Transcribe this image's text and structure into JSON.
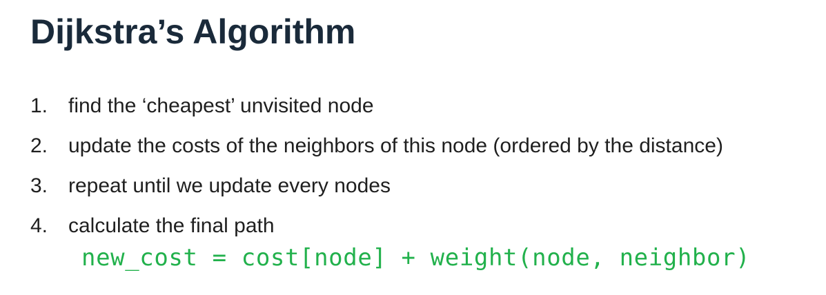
{
  "colors": {
    "title": "#1a2a3a",
    "text": "#1f1f1f",
    "code": "#22b14c",
    "background": "#ffffff"
  },
  "slide": {
    "title": "Dijkstra’s Algorithm",
    "steps": [
      {
        "number": "1.",
        "text": "find the ‘cheapest’ unvisited node"
      },
      {
        "number": "2.",
        "text": "update the costs of the neighbors of this node (ordered by the distance)"
      },
      {
        "number": "3.",
        "text": "repeat until we update every nodes"
      },
      {
        "number": "4.",
        "text": "calculate the final path"
      }
    ],
    "formula": "new_cost = cost[node] + weight(node, neighbor)"
  }
}
